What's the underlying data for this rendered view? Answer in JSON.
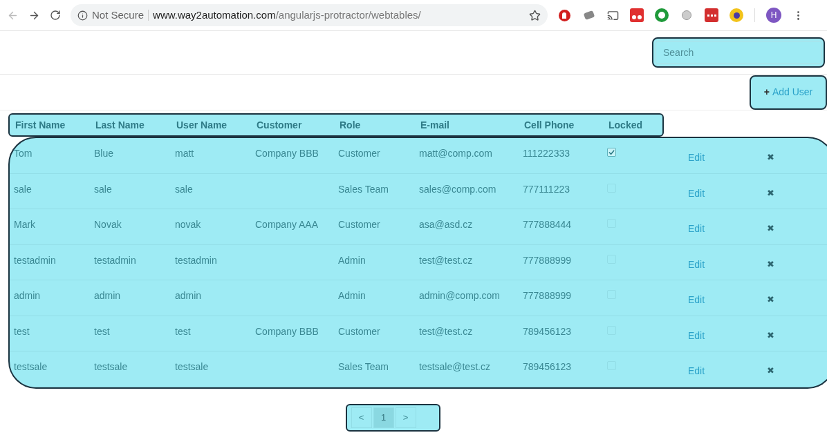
{
  "browser": {
    "security": "Not Secure",
    "url_host": "www.way2automation.com",
    "url_path": "/angularjs-protractor/webtables/",
    "profile": "H"
  },
  "search": {
    "placeholder": "Search"
  },
  "add_user": {
    "icon": "+",
    "label": "Add User"
  },
  "table": {
    "columns": [
      "First Name",
      "Last Name",
      "User Name",
      "Customer",
      "Role",
      "E-mail",
      "Cell Phone",
      "Locked"
    ],
    "rows": [
      {
        "cells": [
          "Tom",
          "Blue",
          "matt",
          "Company BBB",
          "Customer",
          "matt@comp.com",
          "111222333"
        ],
        "locked": true,
        "edit": "Edit",
        "delete": "✖"
      },
      {
        "cells": [
          "sale",
          "sale",
          "sale",
          "",
          "Sales Team",
          "sales@comp.com",
          "777111223"
        ],
        "locked": false,
        "edit": "Edit",
        "delete": "✖"
      },
      {
        "cells": [
          "Mark",
          "Novak",
          "novak",
          "Company AAA",
          "Customer",
          "asa@asd.cz",
          "777888444"
        ],
        "locked": false,
        "edit": "Edit",
        "delete": "✖"
      },
      {
        "cells": [
          "testadmin",
          "testadmin",
          "testadmin",
          "",
          "Admin",
          "test@test.cz",
          "777888999"
        ],
        "locked": false,
        "edit": "Edit",
        "delete": "✖"
      },
      {
        "cells": [
          "admin",
          "admin",
          "admin",
          "",
          "Admin",
          "admin@comp.com",
          "777888999"
        ],
        "locked": false,
        "edit": "Edit",
        "delete": "✖"
      },
      {
        "cells": [
          "test",
          "test",
          "test",
          "Company BBB",
          "Customer",
          "test@test.cz",
          "789456123"
        ],
        "locked": false,
        "edit": "Edit",
        "delete": "✖"
      },
      {
        "cells": [
          "testsale",
          "testsale",
          "testsale",
          "",
          "Sales Team",
          "testsale@test.cz",
          "789456123"
        ],
        "locked": false,
        "edit": "Edit",
        "delete": "✖"
      }
    ]
  },
  "pagination": {
    "prev": "<",
    "pages": [
      {
        "label": "1",
        "selected": true
      }
    ],
    "next": ">"
  }
}
